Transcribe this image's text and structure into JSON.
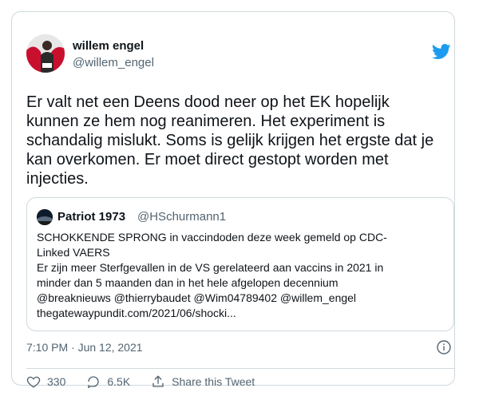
{
  "tweet": {
    "author_name": "willem engel",
    "author_handle": "@willem_engel",
    "text": "Er valt net een Deens dood neer op het EK hopelijk\nkunnen ze hem nog reanimeren. Het experiment is\nschandalig mislukt. Soms is gelijk krijgen het ergste dat je\nkan overkomen. Er moet direct gestopt worden met\ninjecties.",
    "timestamp": "7:10 PM · Jun 12, 2021"
  },
  "quoted": {
    "author_name": "Patriot 1973",
    "author_handle": "@HSchurmann1",
    "text": "SCHOKKENDE SPRONG in vaccindoden deze week gemeld op CDC-\nLinked VAERS\nEr zijn meer Sterfgevallen in de VS gerelateerd aan vaccins in 2021 in\nminder dan 5 maanden dan in het hele afgelopen decennium\n@breaknieuws @thierrybaudet @Wim04789402 @willem_engel\nthegatewaypundit.com/2021/06/shocki..."
  },
  "actions": {
    "likes": "330",
    "replies": "6.5K",
    "share_label": "Share this Tweet"
  },
  "colors": {
    "twitter_blue": "#1d9bf0",
    "text_primary": "#0f1419",
    "text_secondary": "#536471",
    "border": "#cfd9de"
  },
  "icons": [
    "twitter-bird-icon",
    "info-icon",
    "heart-icon",
    "reply-icon",
    "share-icon"
  ]
}
